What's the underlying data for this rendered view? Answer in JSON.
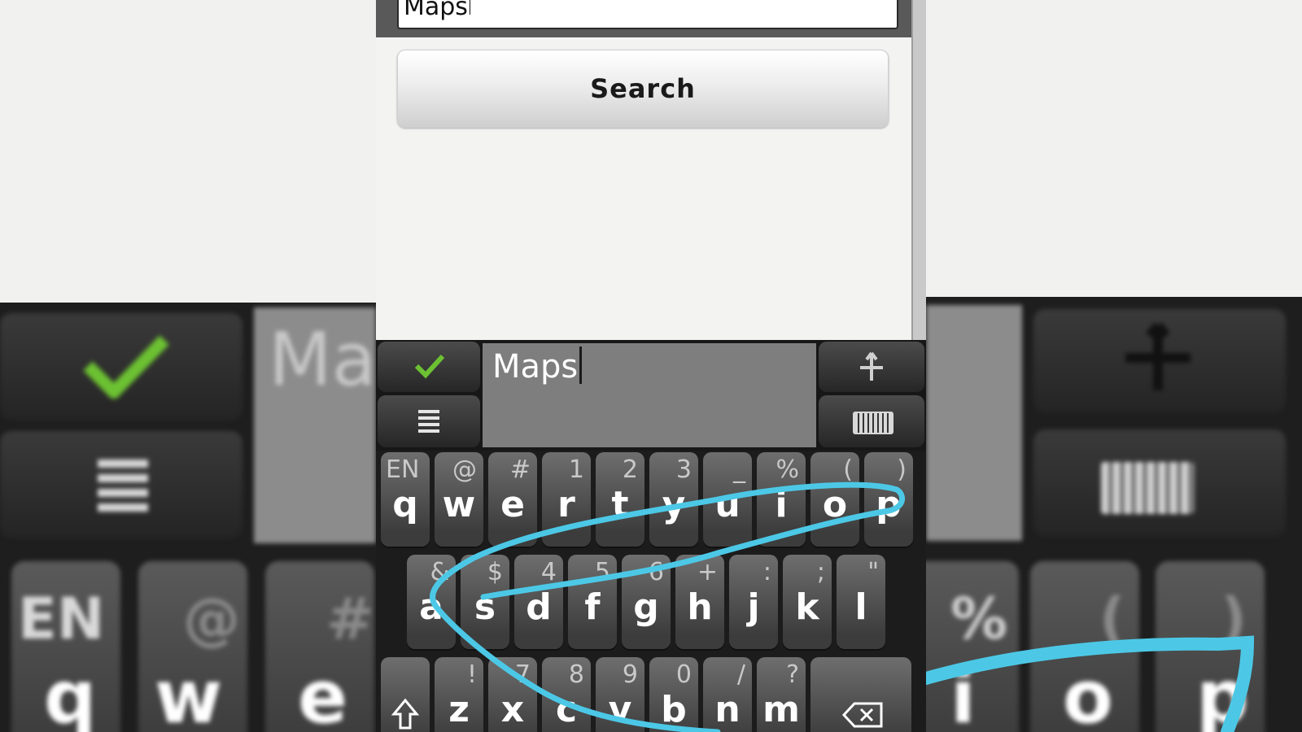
{
  "search_field": {
    "value": "Maps"
  },
  "search_button": {
    "label": "Search"
  },
  "keyboard": {
    "preview_text": "Maps",
    "left_bg_preview": "Ma",
    "rows": [
      [
        {
          "pri": "q",
          "sec": "EN"
        },
        {
          "pri": "w",
          "sec": "@"
        },
        {
          "pri": "e",
          "sec": "#"
        },
        {
          "pri": "r",
          "sec": "1"
        },
        {
          "pri": "t",
          "sec": "2"
        },
        {
          "pri": "y",
          "sec": "3"
        },
        {
          "pri": "u",
          "sec": "_"
        },
        {
          "pri": "i",
          "sec": "%"
        },
        {
          "pri": "o",
          "sec": "("
        },
        {
          "pri": "p",
          "sec": ")"
        }
      ],
      [
        {
          "pri": "a",
          "sec": "&"
        },
        {
          "pri": "s",
          "sec": "$"
        },
        {
          "pri": "d",
          "sec": "4"
        },
        {
          "pri": "f",
          "sec": "5"
        },
        {
          "pri": "g",
          "sec": "6"
        },
        {
          "pri": "h",
          "sec": "+"
        },
        {
          "pri": "j",
          "sec": ":"
        },
        {
          "pri": "k",
          "sec": ";"
        },
        {
          "pri": "l",
          "sec": "\""
        }
      ],
      [
        {
          "pri": "z",
          "sec": "!"
        },
        {
          "pri": "x",
          "sec": "7"
        },
        {
          "pri": "c",
          "sec": "8"
        },
        {
          "pri": "v",
          "sec": "9"
        },
        {
          "pri": "b",
          "sec": "0"
        },
        {
          "pri": "n",
          "sec": "/"
        },
        {
          "pri": "m",
          "sec": "?"
        }
      ]
    ],
    "side_left_keys": [
      {
        "pri": "q",
        "sec": "EN"
      },
      {
        "pri": "w",
        "sec": "@"
      },
      {
        "pri": "e",
        "sec": "#"
      }
    ],
    "side_right_keys": [
      {
        "pri": "i",
        "sec": "%"
      },
      {
        "pri": "o",
        "sec": "("
      },
      {
        "pri": "p",
        "sec": ")"
      }
    ]
  },
  "icons": {
    "confirm": "checkmark-icon",
    "menu": "menu-icon",
    "move": "move-arrows-icon",
    "keyboard": "keyboard-icon",
    "shift": "shift-arrow-icon",
    "backspace": "backspace-icon"
  },
  "colors": {
    "trace": "#4cc8e6",
    "confirm": "#6cc132"
  }
}
